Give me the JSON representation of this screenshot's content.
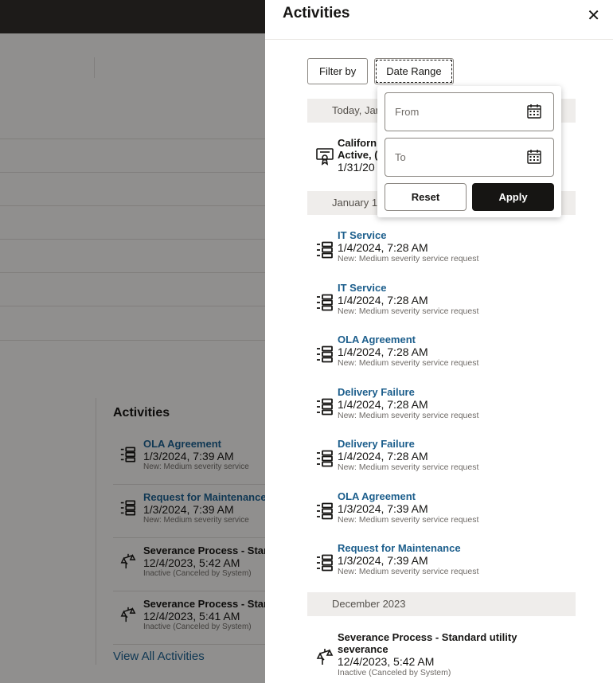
{
  "background": {
    "activities_title": "Activities",
    "items": [
      {
        "icon": "list-icon",
        "title": "OLA Agreement",
        "date": "1/3/2024, 7:39 AM",
        "status": "New: Medium severity service",
        "link": true
      },
      {
        "icon": "list-icon",
        "title": "Request for Maintenance",
        "date": "1/3/2024, 7:39 AM",
        "status": "New: Medium severity service",
        "link": true
      },
      {
        "icon": "scale-icon",
        "title": "Severance Process - Star",
        "date": "12/4/2023, 5:42 AM",
        "status": "Inactive (Canceled by System)",
        "link": false
      },
      {
        "icon": "scale-icon",
        "title": "Severance Process - Star",
        "date": "12/4/2023, 5:41 AM",
        "status": "Inactive (Canceled by System)",
        "link": false
      }
    ],
    "view_all": "View All Activities"
  },
  "drawer": {
    "title": "Activities",
    "close_icon": "close-icon",
    "filter_by": "Filter by",
    "date_range": "Date Range",
    "groups": {
      "today": "Today, Jar",
      "january": "January 1",
      "december": "December 2023"
    },
    "today_item": {
      "icon": "certificate-icon",
      "line1": "Californ",
      "line2": "Active, (",
      "line3": "1/31/20"
    },
    "items": [
      {
        "icon": "list-icon",
        "title": "IT Service",
        "date": "1/4/2024, 7:28 AM",
        "status": "New: Medium severity service request"
      },
      {
        "icon": "list-icon",
        "title": "IT Service",
        "date": "1/4/2024, 7:28 AM",
        "status": "New: Medium severity service request"
      },
      {
        "icon": "list-icon",
        "title": "OLA Agreement",
        "date": "1/4/2024, 7:28 AM",
        "status": "New: Medium severity service request"
      },
      {
        "icon": "list-icon",
        "title": "Delivery Failure",
        "date": "1/4/2024, 7:28 AM",
        "status": "New: Medium severity service request"
      },
      {
        "icon": "list-icon",
        "title": "Delivery Failure",
        "date": "1/4/2024, 7:28 AM",
        "status": "New: Medium severity service request"
      },
      {
        "icon": "list-icon",
        "title": "OLA Agreement",
        "date": "1/3/2024, 7:39 AM",
        "status": "New: Medium severity service request"
      },
      {
        "icon": "list-icon",
        "title": "Request for Maintenance",
        "date": "1/3/2024, 7:39 AM",
        "status": "New: Medium severity service request"
      }
    ],
    "december_item": {
      "icon": "scale-icon",
      "title_line1": "Severance Process - Standard utility",
      "title_line2": "severance",
      "date": "12/4/2023, 5:42 AM",
      "status": "Inactive (Canceled by System)"
    }
  },
  "popup": {
    "from_placeholder": "From",
    "to_placeholder": "To",
    "reset": "Reset",
    "apply": "Apply"
  },
  "colors": {
    "link": "#1c5e8c",
    "topbar": "#312d2a",
    "apply_bg": "#161513"
  }
}
